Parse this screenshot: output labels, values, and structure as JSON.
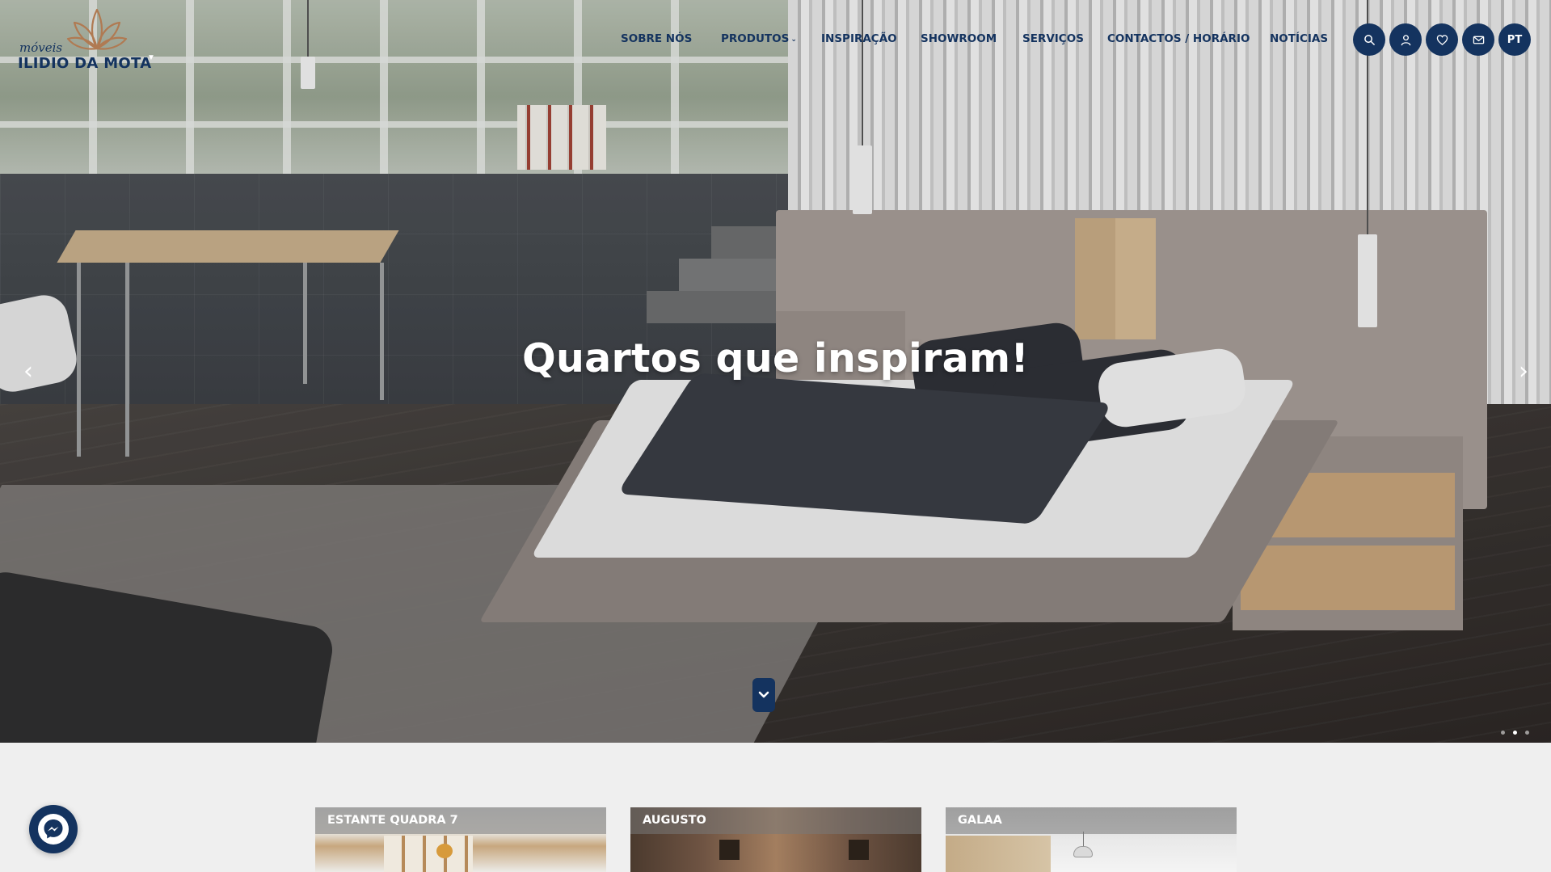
{
  "brand": {
    "small": "móveis",
    "main": "ILIDIO DA MOTA"
  },
  "nav": {
    "items": [
      {
        "label": "SOBRE NÓS"
      },
      {
        "label": "PRODUTOS",
        "has_dropdown": true
      },
      {
        "label": "INSPIRAÇÃO"
      },
      {
        "label": "SHOWROOM"
      },
      {
        "label": "SERVIÇOS"
      },
      {
        "label": "CONTACTOS / HORÁRIO"
      },
      {
        "label": "NOTÍCIAS"
      }
    ]
  },
  "header_buttons": {
    "search_icon": "search-icon",
    "account_icon": "user-icon",
    "wishlist_icon": "heart-icon",
    "contact_icon": "mail-icon",
    "language": "PT"
  },
  "hero": {
    "heading": "Quartos que inspiram!",
    "prev_arrow": "‹",
    "next_arrow": "›",
    "slide_count": 3,
    "active_slide": 2
  },
  "products": [
    {
      "title": "ESTANTE QUADRA 7"
    },
    {
      "title": "AUGUSTO"
    },
    {
      "title": "GALAA"
    }
  ],
  "colors": {
    "brand_navy": "#14335f",
    "logo_accent": "#b07a52",
    "page_background": "#efefef"
  },
  "chat_widget": {
    "icon": "messenger-icon"
  }
}
